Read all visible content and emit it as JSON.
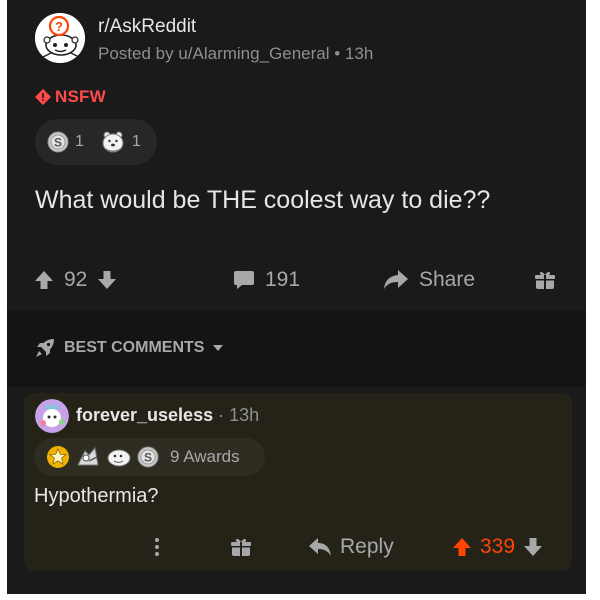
{
  "post": {
    "subreddit": "r/AskReddit",
    "posted_by": "Posted by u/Alarming_General • 13h",
    "nsfw_label": "NSFW",
    "awards": [
      {
        "icon": "silver-coin-icon",
        "count": "1"
      },
      {
        "icon": "bear-hug-icon",
        "count": "1"
      }
    ],
    "title": "What would be THE coolest way to die??",
    "score": "92",
    "comments_count": "191",
    "share_label": "Share"
  },
  "sort": {
    "label": "BEST COMMENTS"
  },
  "comment": {
    "username": "forever_useless",
    "time": "· 13h",
    "awards_label": "9 Awards",
    "award_icons": [
      "gold-star-icon",
      "wholesome-award-icon",
      "seal-award-icon",
      "silver-coin-icon"
    ],
    "body": "Hypothermia?",
    "reply_label": "Reply",
    "score": "339"
  },
  "colors": {
    "background": "#1a1a1b",
    "text": "#e6e6e6",
    "muted": "#a7a8aa",
    "nsfw": "#ff4a4a",
    "upvote": "#ff4500",
    "comment_bg": "#252317"
  }
}
